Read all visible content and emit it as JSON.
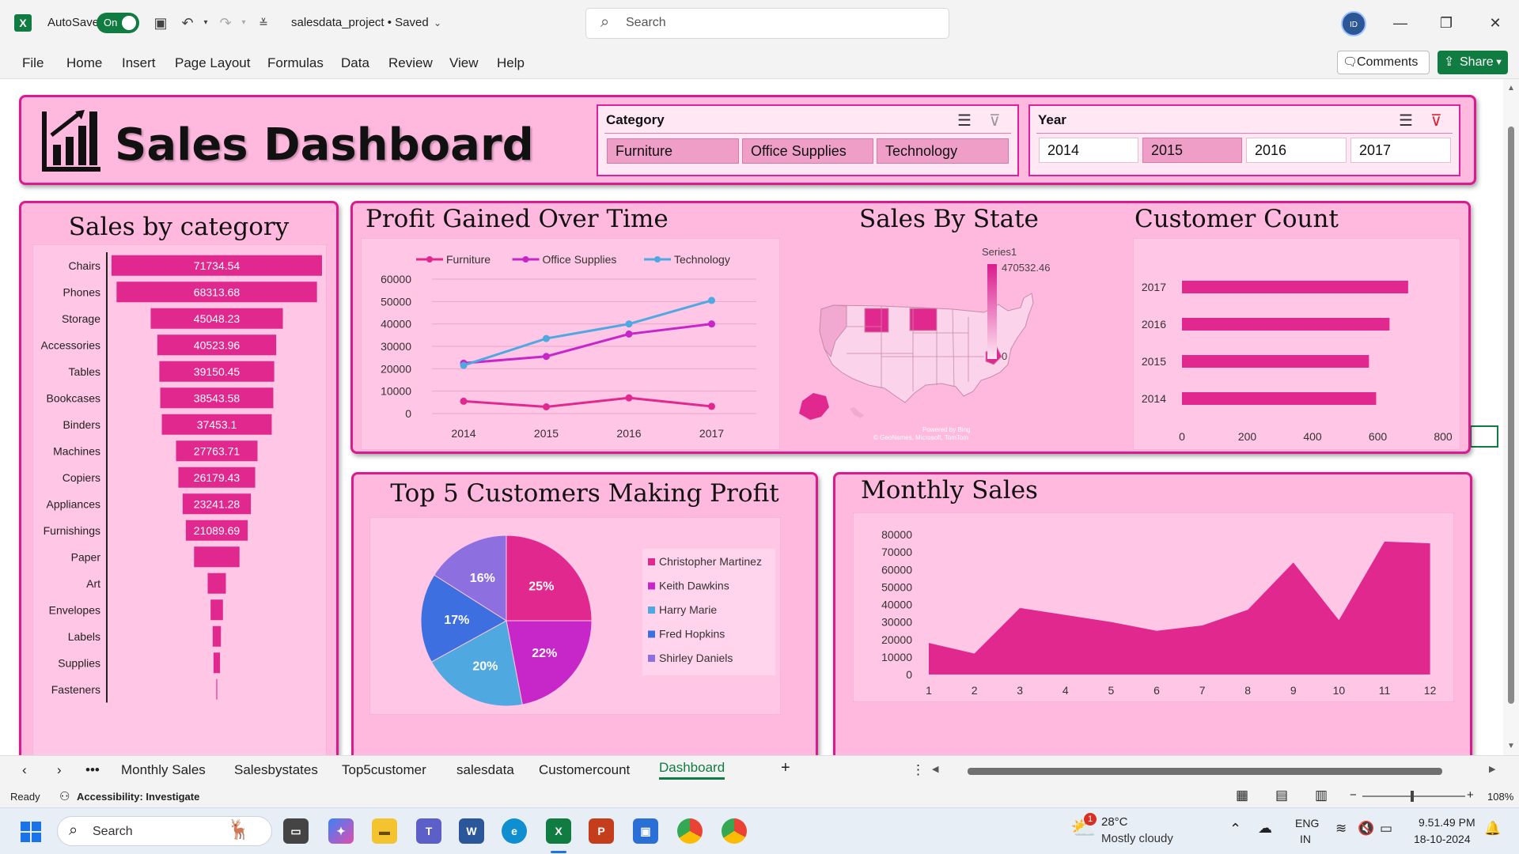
{
  "titlebar": {
    "autosave_label": "AutoSave",
    "autosave_state": "On",
    "file_name": "salesdata_project • Saved",
    "search_placeholder": "Search"
  },
  "ribbon": {
    "menu": [
      "File",
      "Home",
      "Insert",
      "Page Layout",
      "Formulas",
      "Data",
      "Review",
      "View",
      "Help"
    ],
    "comments_label": "Comments",
    "share_label": "Share"
  },
  "dashboard": {
    "title": "Sales Dashboard",
    "category_slicer": {
      "header": "Category",
      "items": [
        {
          "label": "Furniture",
          "selected": true
        },
        {
          "label": "Office Supplies",
          "selected": true
        },
        {
          "label": "Technology",
          "selected": true
        }
      ]
    },
    "year_slicer": {
      "header": "Year",
      "items": [
        {
          "label": "2014",
          "selected": false
        },
        {
          "label": "2015",
          "selected": true
        },
        {
          "label": "2016",
          "selected": false
        },
        {
          "label": "2017",
          "selected": false
        }
      ]
    },
    "panel_titles": {
      "sales_by_category": "Sales by category",
      "profit_over_time": "Profit Gained Over Time",
      "sales_by_state": "Sales By State",
      "customer_count": "Customer Count",
      "top5": "Top 5 Customers Making Profit",
      "monthly_sales": "Monthly Sales"
    },
    "map": {
      "legend_title": "Series1",
      "legend_max": "470532.46",
      "legend_min": "0",
      "credit1": "Powered by Bing",
      "credit2": "© GeoNames, Microsoft, TomTom"
    }
  },
  "chart_data": [
    {
      "id": "sales_by_category",
      "type": "bar",
      "orientation": "horizontal",
      "categories": [
        "Chairs",
        "Phones",
        "Storage",
        "Accessories",
        "Tables",
        "Bookcases",
        "Binders",
        "Machines",
        "Copiers",
        "Appliances",
        "Furnishings",
        "Paper",
        "Art",
        "Envelopes",
        "Labels",
        "Supplies",
        "Fasteners"
      ],
      "values": [
        71734.54,
        68313.68,
        45048.23,
        40523.96,
        39150.45,
        38543.58,
        37453.1,
        27763.71,
        26179.43,
        23241.28,
        21089.69,
        15500,
        6200,
        4200,
        2800,
        2200,
        300
      ],
      "data_labels": [
        "71734.54",
        "68313.68",
        "45048.23",
        "40523.96",
        "39150.45",
        "38543.58",
        "37453.1",
        "27763.71",
        "26179.43",
        "23241.28",
        "21089.69",
        "",
        "",
        "",
        "",
        "",
        ""
      ],
      "color": "#e0288f"
    },
    {
      "id": "profit_over_time",
      "type": "line",
      "x": [
        "2014",
        "2015",
        "2016",
        "2017"
      ],
      "ylim": [
        0,
        60000
      ],
      "yticks": [
        0,
        10000,
        20000,
        30000,
        40000,
        50000,
        60000
      ],
      "series": [
        {
          "name": "Furniture",
          "color": "#e0288f",
          "values": [
            5500,
            3000,
            7000,
            3200
          ]
        },
        {
          "name": "Office Supplies",
          "color": "#c726c9",
          "values": [
            22500,
            25500,
            35500,
            40000
          ]
        },
        {
          "name": "Technology",
          "color": "#4fa8e0",
          "values": [
            21500,
            33500,
            40000,
            50500
          ]
        }
      ]
    },
    {
      "id": "customer_count",
      "type": "bar",
      "orientation": "horizontal",
      "categories": [
        "2017",
        "2016",
        "2015",
        "2014"
      ],
      "values": [
        693,
        636,
        573,
        595
      ],
      "xlim": [
        0,
        800
      ],
      "xticks": [
        0,
        200,
        400,
        600,
        800
      ],
      "color": "#e0288f"
    },
    {
      "id": "top5_customers",
      "type": "pie",
      "labels": [
        "Christopher Martinez",
        "Keith Dawkins",
        "Harry Marie",
        "Fred Hopkins",
        "Shirley Daniels"
      ],
      "values": [
        25,
        22,
        20,
        17,
        16
      ],
      "data_labels": [
        "25%",
        "22%",
        "20%",
        "17%",
        "16%"
      ],
      "colors": [
        "#e0288f",
        "#c726c9",
        "#4fa8e0",
        "#3d6fe0",
        "#8e6fe0"
      ]
    },
    {
      "id": "monthly_sales",
      "type": "area",
      "x": [
        1,
        2,
        3,
        4,
        5,
        6,
        7,
        8,
        9,
        10,
        11,
        12
      ],
      "values": [
        18000,
        12000,
        38000,
        34000,
        30000,
        25000,
        28000,
        37000,
        64000,
        31000,
        76000,
        75000
      ],
      "ylim": [
        0,
        80000
      ],
      "yticks": [
        0,
        10000,
        20000,
        30000,
        40000,
        50000,
        60000,
        70000,
        80000
      ],
      "color": "#e0288f"
    }
  ],
  "sheet_tabs": {
    "items": [
      "Monthly Sales",
      "Salesbystates",
      "Top5customer",
      "salesdata",
      "Customercount",
      "Dashboard"
    ],
    "active": "Dashboard"
  },
  "status": {
    "ready": "Ready",
    "accessibility": "Accessibility: Investigate",
    "zoom": "108%"
  },
  "taskbar": {
    "search_placeholder": "Search",
    "weather_temp": "28°C",
    "weather_desc": "Mostly cloudy",
    "weather_badge": "1",
    "lang1": "ENG",
    "lang2": "IN",
    "time": "9.51.49 PM",
    "date": "18-10-2024"
  }
}
